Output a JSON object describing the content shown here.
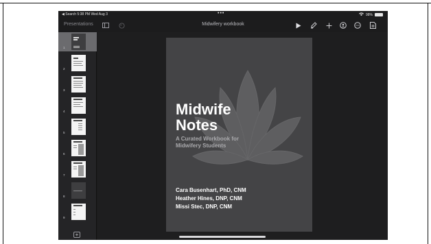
{
  "status_bar": {
    "back_app": "◀ Search",
    "time": "5:38 PM",
    "date": "Wed Aug 3",
    "dots": "•••",
    "battery_percent": "98%",
    "battery_level": 0.98
  },
  "toolbar": {
    "back_label": "Presentations",
    "document_title": "Midwifery workbook",
    "icons": [
      "sidebar-toggle",
      "undo",
      "play",
      "format-brush",
      "add",
      "collaborate",
      "more",
      "document-options"
    ]
  },
  "sidebar": {
    "slides": [
      {
        "number": "1",
        "selected": true
      },
      {
        "number": "2",
        "selected": false
      },
      {
        "number": "3",
        "selected": false
      },
      {
        "number": "4",
        "selected": false
      },
      {
        "number": "5",
        "selected": false
      },
      {
        "number": "6",
        "selected": false
      },
      {
        "number": "7",
        "selected": false
      },
      {
        "number": "8",
        "selected": false
      },
      {
        "number": "9",
        "selected": false
      }
    ],
    "add_label": "+"
  },
  "slide": {
    "title_line1": "Midwife",
    "title_line2": "Notes",
    "subtitle_line1": "A Curated Workbook for",
    "subtitle_line2": "Midwifery Students",
    "authors": [
      "Cara Busenhart, PhD, CNM",
      "Heather Hines, DNP, CNM",
      "Missi Stec, DNP, CNM"
    ]
  }
}
